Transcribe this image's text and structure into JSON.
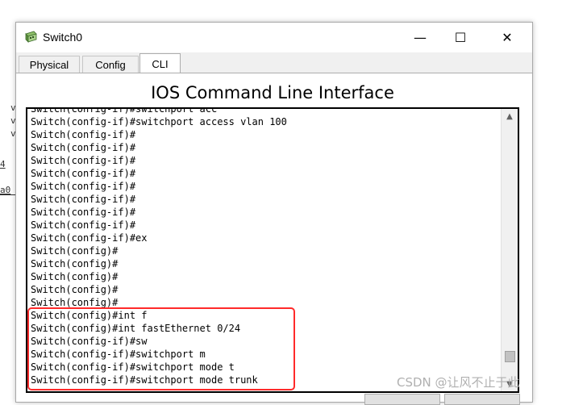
{
  "window": {
    "title": "Switch0",
    "minimize_glyph": "—",
    "maximize_glyph": "☐",
    "close_glyph": "✕"
  },
  "tabs": [
    {
      "label": "Physical",
      "active": false
    },
    {
      "label": "Config",
      "active": false
    },
    {
      "label": "CLI",
      "active": true
    }
  ],
  "cli": {
    "heading": "IOS Command Line Interface",
    "lines": [
      "Switch(config-if)#switchport acc",
      "Switch(config-if)#switchport access vlan 100",
      "Switch(config-if)#",
      "Switch(config-if)#",
      "Switch(config-if)#",
      "Switch(config-if)#",
      "Switch(config-if)#",
      "Switch(config-if)#",
      "Switch(config-if)#",
      "Switch(config-if)#",
      "Switch(config-if)#ex",
      "Switch(config)#",
      "Switch(config)#",
      "Switch(config)#",
      "Switch(config)#",
      "Switch(config)#",
      "Switch(config)#int f",
      "Switch(config)#int fastEthernet 0/24",
      "Switch(config-if)#sw",
      "Switch(config-if)#switchport m",
      "Switch(config-if)#switchport mode t",
      "Switch(config-if)#switchport mode trunk"
    ]
  },
  "background_fragments": [
    "v",
    "v",
    "v",
    "4",
    "a0"
  ],
  "watermark": "CSDN @让风不止于此",
  "colors": {
    "highlight": "#ff2a2a",
    "terminal_border": "#000000"
  }
}
